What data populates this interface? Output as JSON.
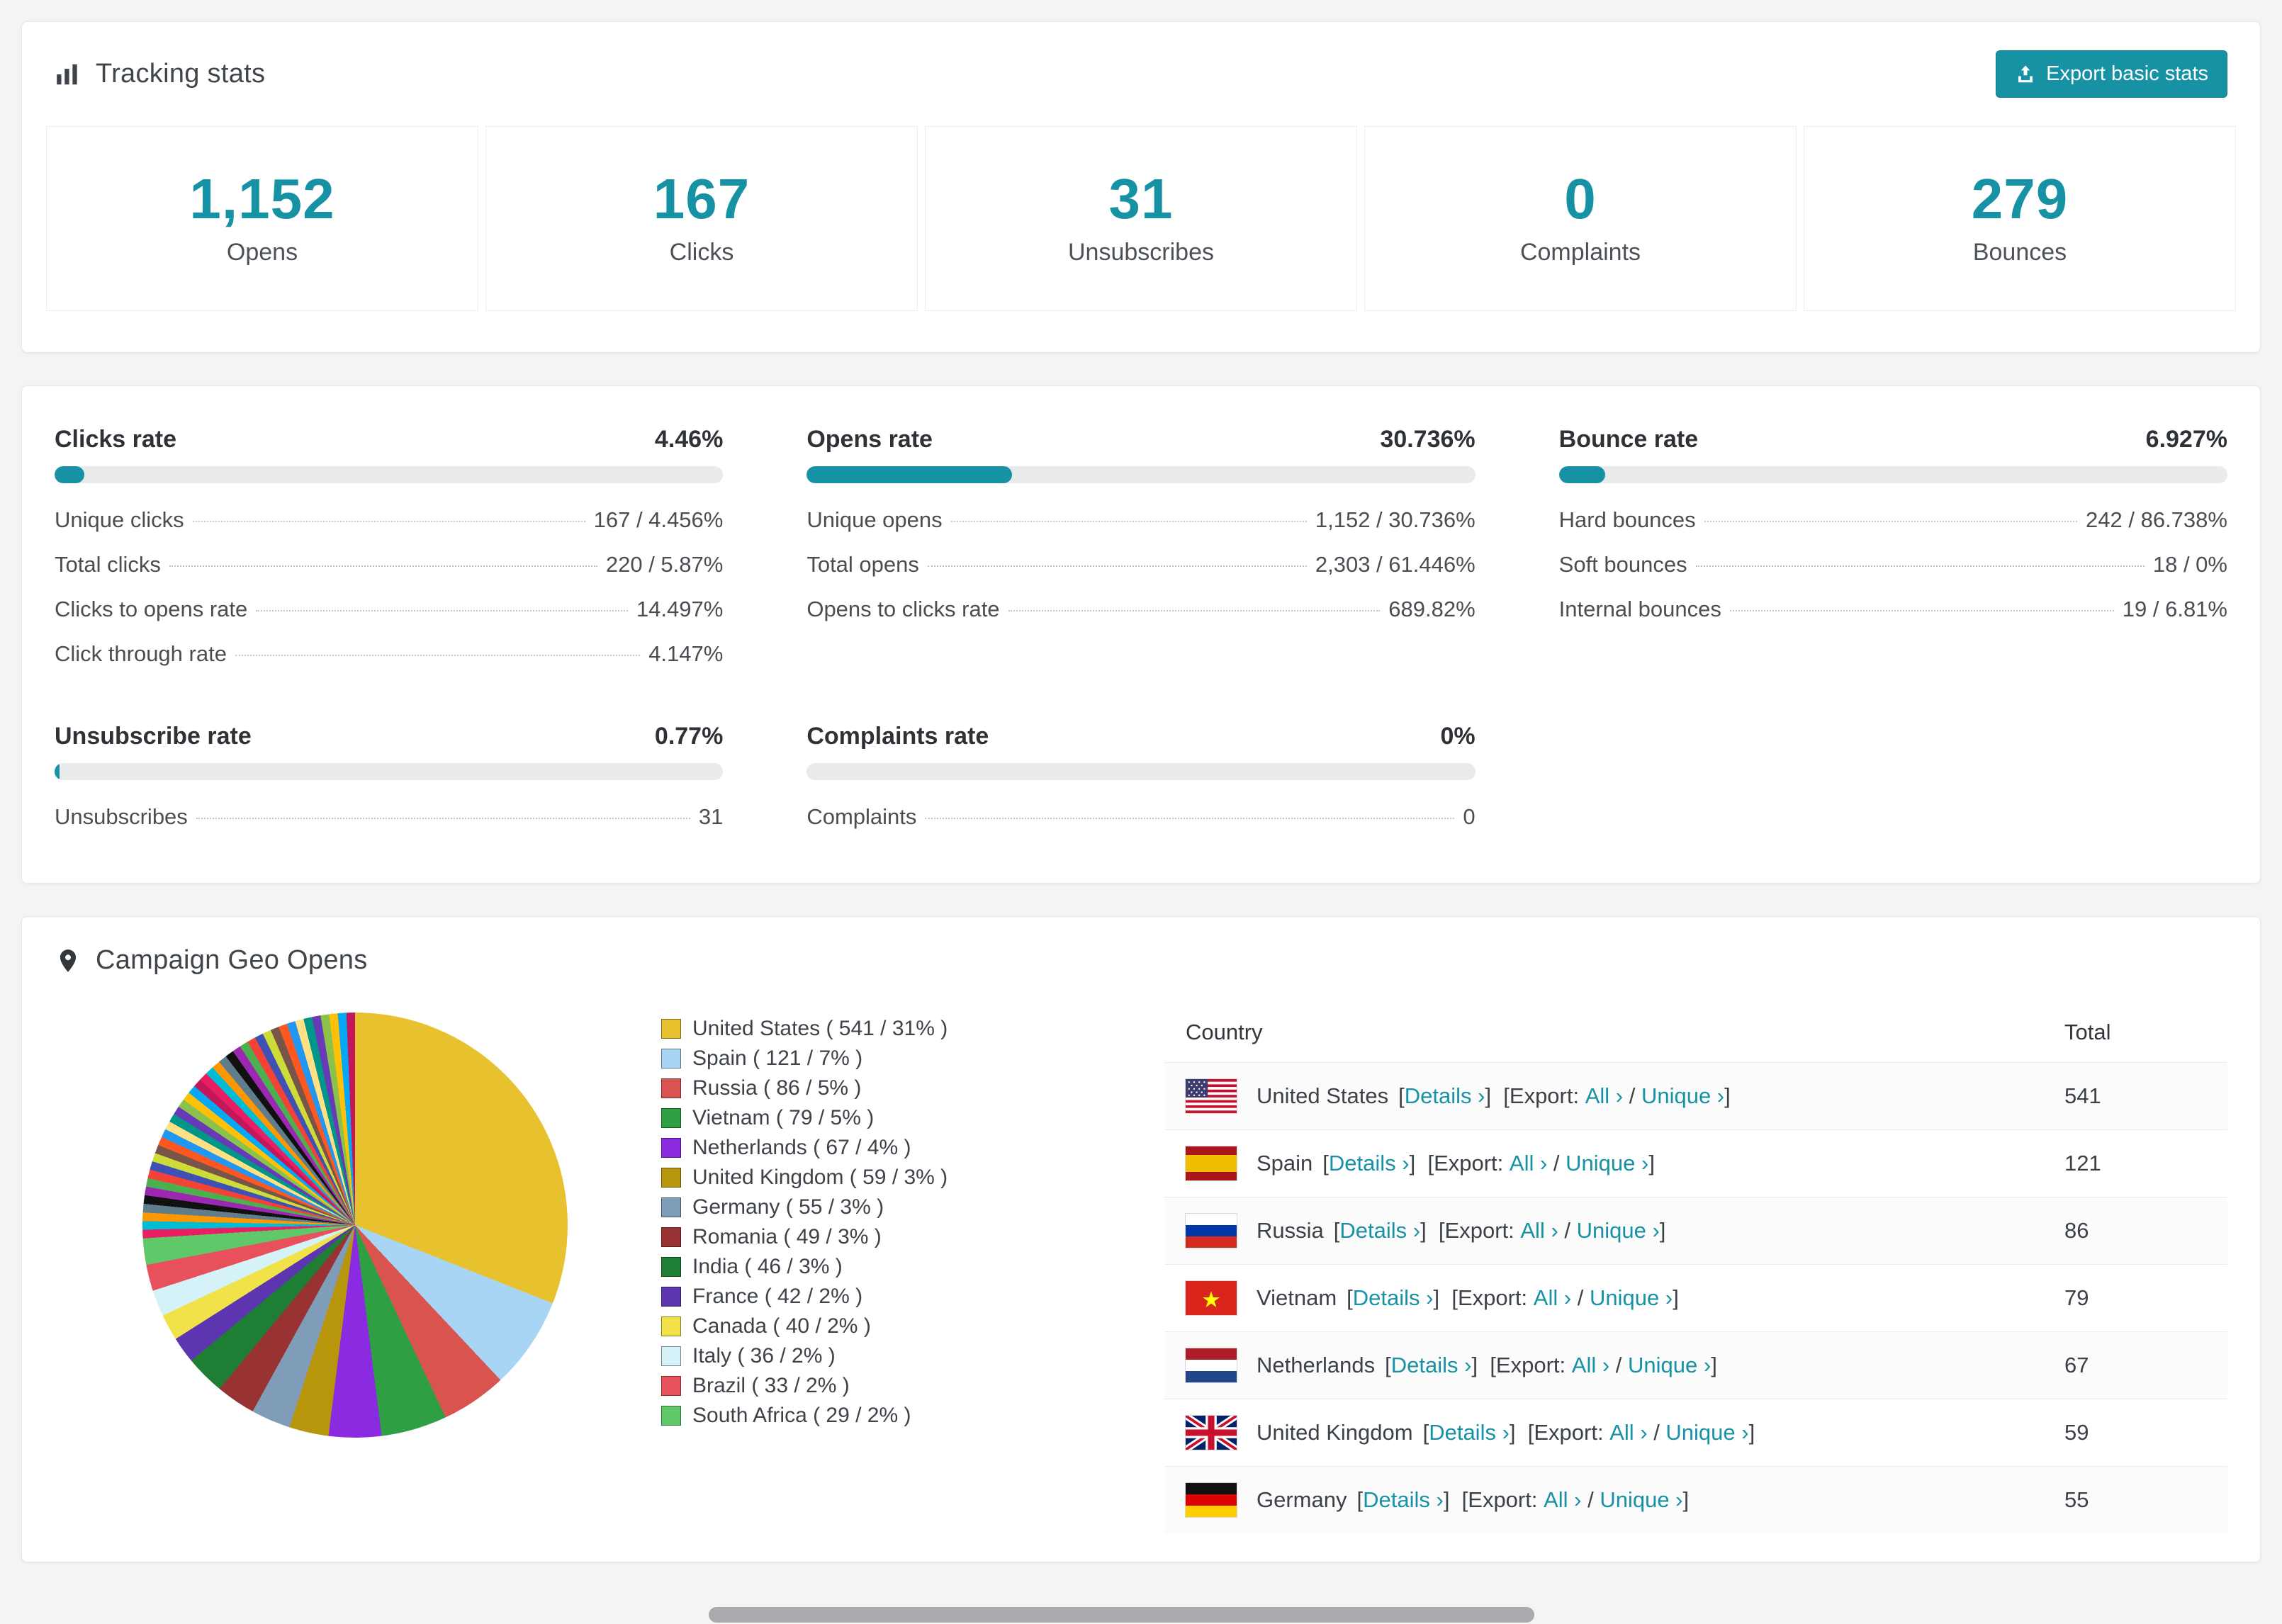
{
  "theme": {
    "accent": "#1792a5",
    "bar_track": "#e9eaeb",
    "page_background": "#f3f4f4"
  },
  "tracking": {
    "title": "Tracking stats",
    "export_button": "Export basic stats",
    "stats": [
      {
        "value": "1,152",
        "label": "Opens"
      },
      {
        "value": "167",
        "label": "Clicks"
      },
      {
        "value": "31",
        "label": "Unsubscribes"
      },
      {
        "value": "0",
        "label": "Complaints"
      },
      {
        "value": "279",
        "label": "Bounces"
      }
    ]
  },
  "rates": [
    {
      "id": "clicks",
      "title": "Clicks rate",
      "value": "4.46%",
      "percent": 4.46,
      "rows": [
        [
          "Unique clicks",
          "167 / 4.456%"
        ],
        [
          "Total clicks",
          "220 / 5.87%"
        ],
        [
          "Clicks to opens rate",
          "14.497%"
        ],
        [
          "Click through rate",
          "4.147%"
        ]
      ]
    },
    {
      "id": "opens",
      "title": "Opens rate",
      "value": "30.736%",
      "percent": 30.736,
      "rows": [
        [
          "Unique opens",
          "1,152 / 30.736%"
        ],
        [
          "Total opens",
          "2,303 / 61.446%"
        ],
        [
          "Opens to clicks rate",
          "689.82%"
        ]
      ]
    },
    {
      "id": "bounce",
      "title": "Bounce rate",
      "value": "6.927%",
      "percent": 6.927,
      "rows": [
        [
          "Hard bounces",
          "242 / 86.738%"
        ],
        [
          "Soft bounces",
          "18 / 0%"
        ],
        [
          "Internal bounces",
          "19 / 6.81%"
        ]
      ]
    },
    {
      "id": "unsubscribe",
      "title": "Unsubscribe rate",
      "value": "0.77%",
      "percent": 0.77,
      "rows": [
        [
          "Unsubscribes",
          "31"
        ]
      ]
    },
    {
      "id": "complaints",
      "title": "Complaints rate",
      "value": "0%",
      "percent": 0,
      "rows": [
        [
          "Complaints",
          "0"
        ]
      ]
    }
  ],
  "geo": {
    "title": "Campaign Geo Opens",
    "chart_data": {
      "type": "pie",
      "title": "Campaign Geo Opens",
      "legend_position": "right",
      "slices": [
        {
          "label": "United States",
          "value": 541,
          "percent": 31,
          "color": "#e8c12e"
        },
        {
          "label": "Spain",
          "value": 121,
          "percent": 7,
          "color": "#a9d5f5"
        },
        {
          "label": "Russia",
          "value": 86,
          "percent": 5,
          "color": "#d9534f"
        },
        {
          "label": "Vietnam",
          "value": 79,
          "percent": 5,
          "color": "#2ea043"
        },
        {
          "label": "Netherlands",
          "value": 67,
          "percent": 4,
          "color": "#8a2be2"
        },
        {
          "label": "United Kingdom",
          "value": 59,
          "percent": 3,
          "color": "#b8960c"
        },
        {
          "label": "Germany",
          "value": 55,
          "percent": 3,
          "color": "#7f9db9"
        },
        {
          "label": "Romania",
          "value": 49,
          "percent": 3,
          "color": "#993333"
        },
        {
          "label": "India",
          "value": 46,
          "percent": 3,
          "color": "#1e7e34"
        },
        {
          "label": "France",
          "value": 42,
          "percent": 2,
          "color": "#5e35b1"
        },
        {
          "label": "Canada",
          "value": 40,
          "percent": 2,
          "color": "#f2e24a"
        },
        {
          "label": "Italy",
          "value": 36,
          "percent": 2,
          "color": "#d5f2f9"
        },
        {
          "label": "Brazil",
          "value": 33,
          "percent": 2,
          "color": "#e8505b"
        },
        {
          "label": "South Africa",
          "value": 29,
          "percent": 2,
          "color": "#5fc96a"
        }
      ],
      "others_percent": 26,
      "others_slice_count": 40,
      "others_colors": [
        "#e91e63",
        "#00bcd4",
        "#ff9800",
        "#607d8b",
        "#111111",
        "#9c27b0",
        "#4caf50",
        "#f44336",
        "#3f51b5",
        "#cddc39",
        "#795548",
        "#ff5722",
        "#2196f3",
        "#ffe082",
        "#009688",
        "#673ab7",
        "#8bc34a",
        "#ffc107",
        "#03a9f4",
        "#c2185b"
      ]
    },
    "table": {
      "headers": [
        "Country",
        "Total"
      ],
      "link_labels": {
        "details": "Details ›",
        "export": "Export:",
        "all": "All ›",
        "unique": "Unique ›"
      },
      "rows": [
        {
          "flag": "us",
          "country": "United States",
          "total": "541"
        },
        {
          "flag": "es",
          "country": "Spain",
          "total": "121"
        },
        {
          "flag": "ru",
          "country": "Russia",
          "total": "86"
        },
        {
          "flag": "vn",
          "country": "Vietnam",
          "total": "79"
        },
        {
          "flag": "nl",
          "country": "Netherlands",
          "total": "67"
        },
        {
          "flag": "gb",
          "country": "United Kingdom",
          "total": "59"
        },
        {
          "flag": "de",
          "country": "Germany",
          "total": "55"
        }
      ]
    }
  }
}
